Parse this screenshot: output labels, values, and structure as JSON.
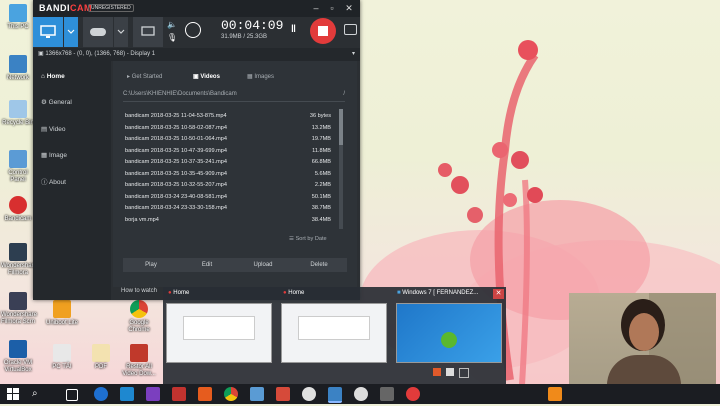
{
  "desktop_icons": [
    {
      "label": "This PC"
    },
    {
      "label": "Network"
    },
    {
      "label": "Recycle Bin"
    },
    {
      "label": "Control Panel"
    },
    {
      "label": "Bandicam"
    },
    {
      "label": "Wondershare Filmora"
    },
    {
      "label": "Wondershare Filmora Scrn"
    },
    {
      "label": "Oracle VM VirtualBox"
    },
    {
      "label": "Uniboot Lite"
    },
    {
      "label": "Google Chrome"
    },
    {
      "label": "PC TẢI"
    },
    {
      "label": "PDF"
    },
    {
      "label": "Restor All Video Dow..."
    }
  ],
  "bandicam": {
    "brand": "BANDI",
    "brand_accent": "CAM",
    "unregistered": "UNREGISTERED",
    "timer": "00:04:09",
    "size": "31.9MB / 25.3GB",
    "display_info": "1366x768 - (0, 0), (1366, 768) - Display 1",
    "nav": [
      "Home",
      "General",
      "Video",
      "Image",
      "About"
    ],
    "tabs": [
      "Get Started",
      "Videos",
      "Images"
    ],
    "path": "C:\\Users\\KHIENHIE\\Documents\\Bandicam",
    "path_up": "/",
    "files": [
      {
        "name": "bandicam 2018-03-25 11-04-53-875.mp4",
        "size": "36 bytes"
      },
      {
        "name": "bandicam 2018-03-25 10-58-02-087.mp4",
        "size": "13.2MB"
      },
      {
        "name": "bandicam 2018-03-25 10-50-01-064.mp4",
        "size": "19.7MB"
      },
      {
        "name": "bandicam 2018-03-25 10-47-39-699.mp4",
        "size": "11.8MB"
      },
      {
        "name": "bandicam 2018-03-25 10-37-35-241.mp4",
        "size": "66.8MB"
      },
      {
        "name": "bandicam 2018-03-25 10-35-45-909.mp4",
        "size": "5.6MB"
      },
      {
        "name": "bandicam 2018-03-25 10-32-55-207.mp4",
        "size": "2.2MB"
      },
      {
        "name": "bandicam 2018-03-24 23-40-08-581.mp4",
        "size": "50.1MB"
      },
      {
        "name": "bandicam 2018-03-24 23-33-30-158.mp4",
        "size": "38.7MB"
      },
      {
        "name": "borja vm.mp4",
        "size": "38.4MB"
      }
    ],
    "sort_label": "Sort by Date",
    "actions": [
      "Play",
      "Edit",
      "Upload",
      "Delete"
    ],
    "howto": "How to watch"
  },
  "alt_tab": {
    "items": [
      {
        "title": "Home"
      },
      {
        "title": "Home"
      },
      {
        "title": "Windows 7 [ FERNANDEZ..."
      }
    ],
    "close": "✕"
  },
  "taskbar": {
    "search_icon": "⌕"
  }
}
